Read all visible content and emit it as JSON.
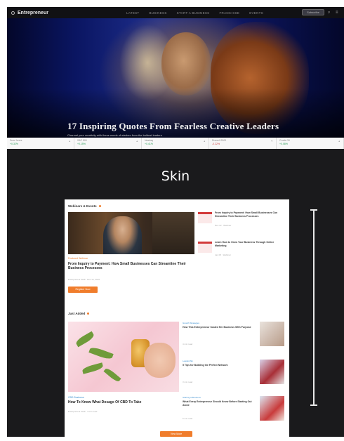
{
  "nav": {
    "brand": "Entrepreneur",
    "links": [
      "Latest",
      "Business",
      "Start a Business",
      "Franchise",
      "Events"
    ],
    "pill": "Subscribe"
  },
  "hero": {
    "title": "17 Inspiring Quotes From Fearless Creative Leaders",
    "subtitle": "Channel your creativity with these words of wisdom from the boldest leaders"
  },
  "ticker": [
    {
      "label": "Dow Jones",
      "value": "+0.32%",
      "trend": "up"
    },
    {
      "label": "S&P 500",
      "value": "+0.15%",
      "trend": "up"
    },
    {
      "label": "Nasdaq",
      "value": "+0.41%",
      "trend": "up"
    },
    {
      "label": "Russell 2000",
      "value": "-0.22%",
      "trend": "down"
    },
    {
      "label": "Crude Oil",
      "value": "+0.08%",
      "trend": "up"
    }
  ],
  "skin_label": "Skin",
  "preview": {
    "section1_title": "Webinars & Events",
    "side_items": [
      {
        "title": "From Inquiry to Payment: How Small Businesses Can Streamline Their Business Processes",
        "meta": "Dec 12 · Webinar"
      },
      {
        "title": "Learn How to Grow Your Business Through Online Marketing",
        "meta": "Jan 05 · Webinar"
      }
    ],
    "feature": {
      "kicker": "Featured Webinar",
      "headline": "From Inquiry to Payment: How Small Businesses Can Streamline Their Business Processes",
      "byline": "Entrepreneur Staff · Dec 12, 2019",
      "cta": "Register Now"
    },
    "section2_title": "Just Added",
    "latest": {
      "kicker": "CBD Business",
      "headline": "How To Know What Dosage Of CBD To Take",
      "byline": "Entrepreneur Staff · 4 min read"
    },
    "list": [
      {
        "kicker": "Growth Strategies",
        "title": "How This Entrepreneur Scaled Her Business With Purpose",
        "meta": "4 min read"
      },
      {
        "kicker": "Leadership",
        "title": "5 Tips for Building the Perfect Network",
        "meta": "3 min read"
      },
      {
        "kicker": "Starting a Business",
        "title": "What Every Entrepreneur Should Know Before Starting Out Alone",
        "meta": "5 min read"
      }
    ],
    "bottom_cta": "View More"
  }
}
